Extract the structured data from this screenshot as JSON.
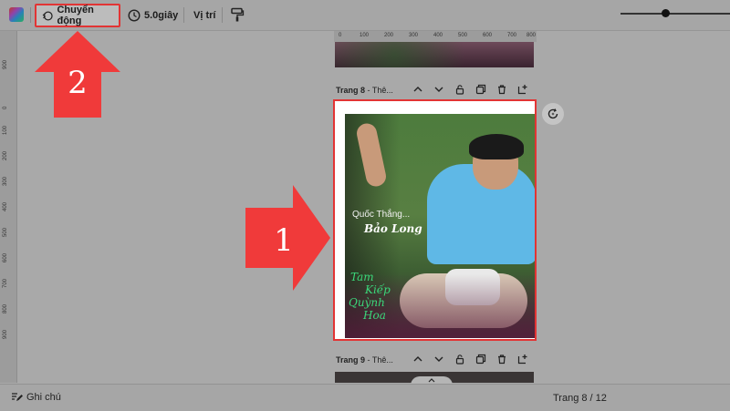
{
  "toolbar": {
    "animate_label": "Chuyển động",
    "duration_label": "5.0giây",
    "position_label": "Vị trí"
  },
  "ruler": {
    "top_ticks": [
      "0",
      "100",
      "200",
      "300",
      "400",
      "500",
      "600",
      "700",
      "800"
    ],
    "left_ticks": [
      "900",
      "0",
      "100",
      "200",
      "300",
      "400",
      "500",
      "600",
      "700",
      "800",
      "900"
    ]
  },
  "pages": {
    "page8_title_bold": "Trang 8",
    "page8_title_rest": " - Thê...",
    "page9_title_bold": "Trang 9",
    "page9_title_rest": " - Thê..."
  },
  "design": {
    "line1": "Quốc Thắng...",
    "line2": "Bảo Long",
    "line3": "Tam",
    "line4": "Kiếp",
    "line5": "Quỳnh",
    "line6": "Hoa"
  },
  "annotations": {
    "arrow1_number": "1",
    "arrow2_number": "2"
  },
  "bottombar": {
    "notes_label": "Ghi chú",
    "page_indicator": "Trang 8 / 12"
  },
  "zoom": {
    "level_fraction": 0.38
  },
  "colors": {
    "highlight": "#e23434",
    "arrow": "#f03a3a"
  }
}
